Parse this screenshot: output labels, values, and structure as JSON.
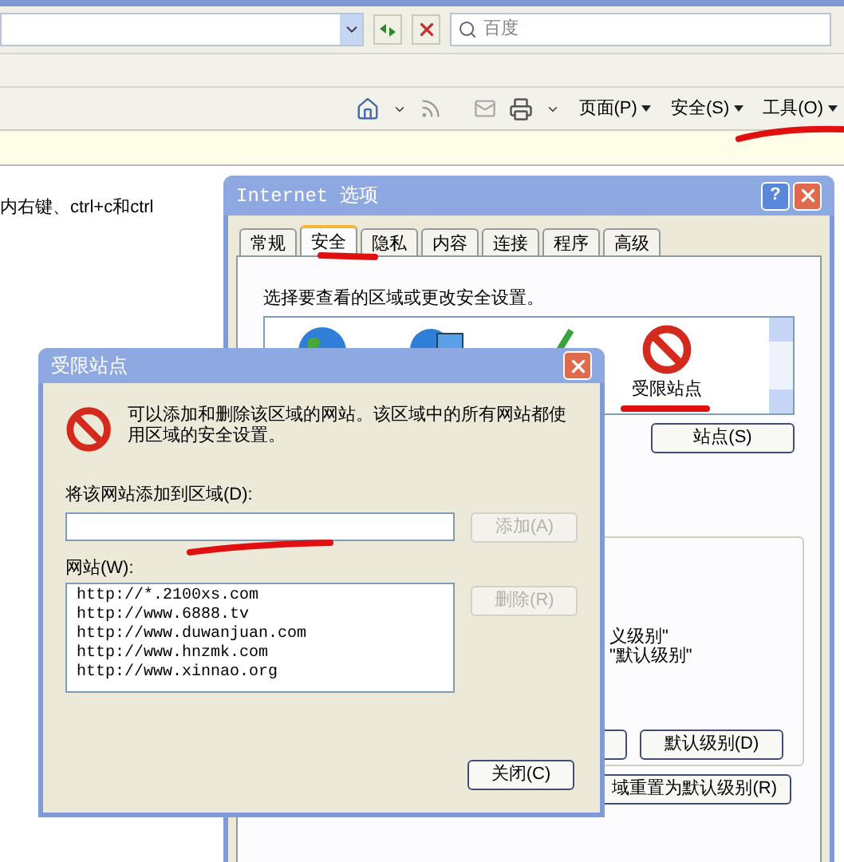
{
  "browser": {
    "search_field": {
      "placeholder": "百度"
    },
    "command_menus": [
      {
        "label": "页面(P)"
      },
      {
        "label": "安全(S)"
      },
      {
        "label": "工具(O)"
      }
    ],
    "page_text": "内右键、ctrl+c和ctrl"
  },
  "internet_options": {
    "title": "Internet 选项",
    "help_button": "?",
    "tabs": [
      {
        "label": "常规",
        "selected": false
      },
      {
        "label": "安全",
        "selected": true
      },
      {
        "label": "隐私",
        "selected": false
      },
      {
        "label": "内容",
        "selected": false
      },
      {
        "label": "连接",
        "selected": false
      },
      {
        "label": "程序",
        "selected": false
      },
      {
        "label": "高级",
        "selected": false
      }
    ],
    "zone_prompt": "选择要查看的区域或更改安全设置。",
    "zones": [
      {
        "kind": "internet"
      },
      {
        "kind": "intranet"
      },
      {
        "kind": "trusted"
      },
      {
        "kind": "restricted",
        "label": "受限站点"
      }
    ],
    "sites_button": "站点(S)",
    "level_texts": [
      "义级别\"",
      "\"默认级别\""
    ],
    "default_level_button": "默认级别(D)",
    "reset_button": "域重置为默认级别(R)"
  },
  "restricted_sites": {
    "title": "受限站点",
    "description": "可以添加和删除该区域的网站。该区域中的所有网站都使用区域的安全设置。",
    "add_label": "将该网站添加到区域(D):",
    "add_button": {
      "label": "添加(A)",
      "disabled": true
    },
    "websites_label": "网站(W):",
    "websites": [
      "http://*.2100xs.com",
      "http://www.6888.tv",
      "http://www.duwanjuan.com",
      "http://www.hnzmk.com",
      "http://www.xinnao.org"
    ],
    "remove_button": {
      "label": "删除(R)",
      "disabled": true
    },
    "close_button": "关闭(C)"
  }
}
